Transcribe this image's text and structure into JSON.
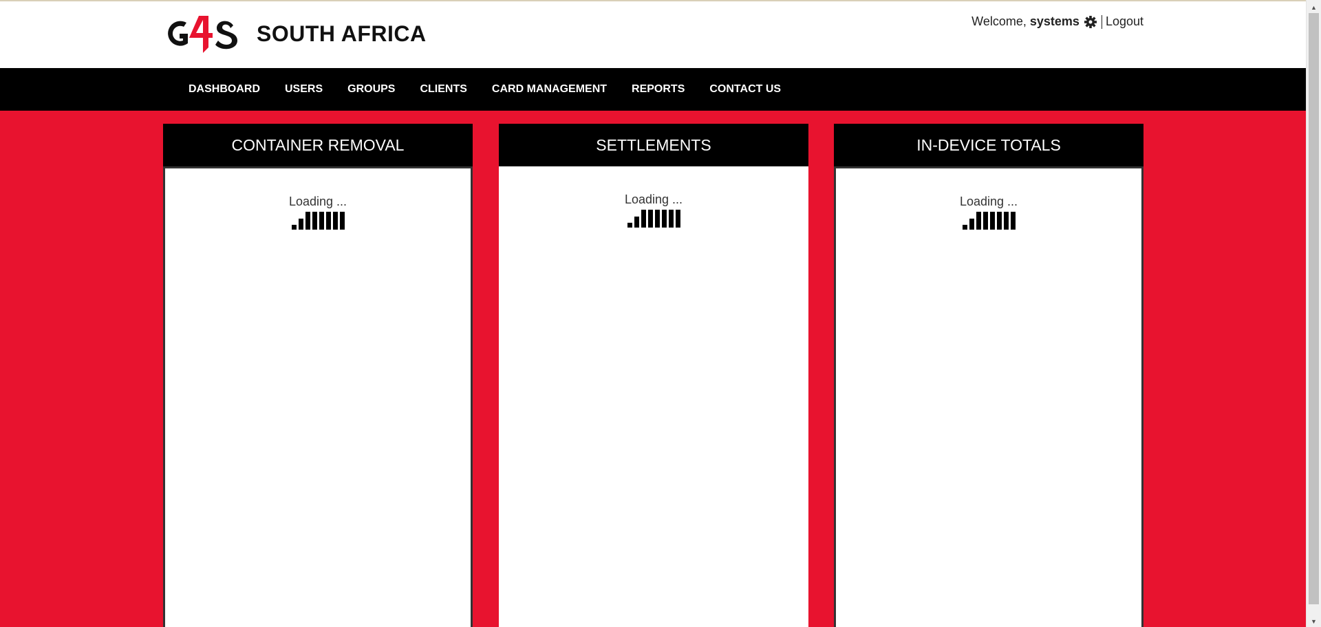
{
  "brand": {
    "logo_text": "G4S",
    "name": "SOUTH AFRICA",
    "logo_red": "#e8132f"
  },
  "user": {
    "welcome": "Welcome,",
    "username": "systems",
    "settings_icon": "gear-icon",
    "logout": "Logout"
  },
  "nav": {
    "items": [
      "DASHBOARD",
      "USERS",
      "GROUPS",
      "CLIENTS",
      "CARD MANAGEMENT",
      "REPORTS",
      "CONTACT US"
    ]
  },
  "panels": [
    {
      "title": "CONTAINER REMOVAL",
      "status": "Loading ..."
    },
    {
      "title": "SETTLEMENTS",
      "status": "Loading ..."
    },
    {
      "title": "IN-DEVICE TOTALS",
      "status": "Loading ..."
    }
  ],
  "colors": {
    "background_red": "#e8132f",
    "header_black": "#000000"
  }
}
